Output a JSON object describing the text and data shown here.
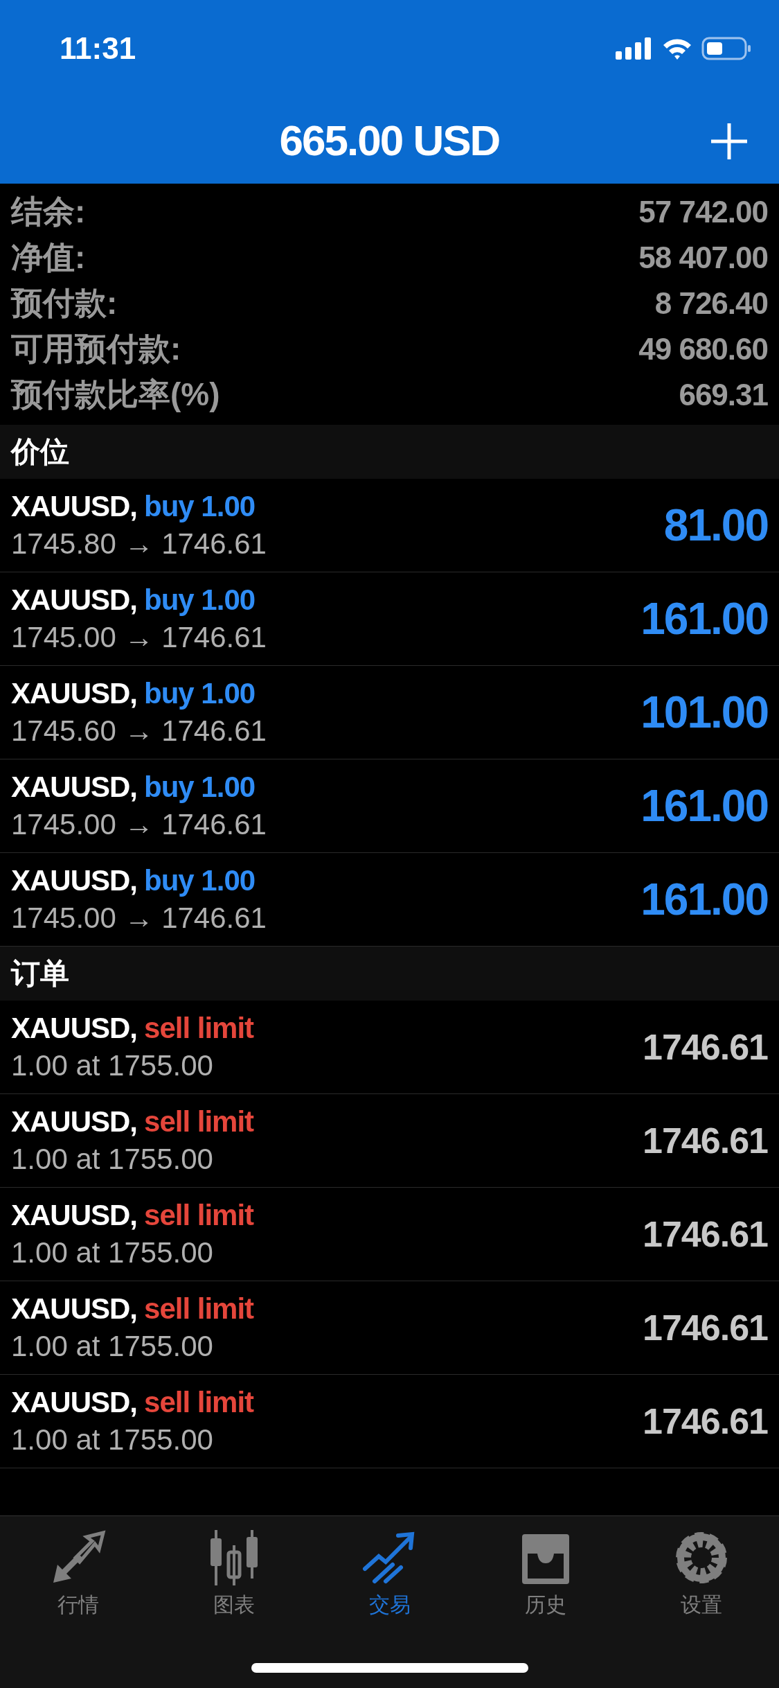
{
  "status_bar": {
    "time": "11:31"
  },
  "header": {
    "title": "665.00 USD"
  },
  "summary": [
    {
      "label": "结余:",
      "value": "57 742.00"
    },
    {
      "label": "净值:",
      "value": "58 407.00"
    },
    {
      "label": "预付款:",
      "value": "8 726.40"
    },
    {
      "label": "可用预付款:",
      "value": "49 680.60"
    },
    {
      "label": "预付款比率(%)",
      "value": "669.31"
    }
  ],
  "positions": {
    "title": "价位",
    "rows": [
      {
        "symbol": "XAUUSD,",
        "kind": "buy",
        "type": "buy 1.00",
        "prices": "1745.80 → 1746.61",
        "profit": "81.00"
      },
      {
        "symbol": "XAUUSD,",
        "kind": "buy",
        "type": "buy 1.00",
        "prices": "1745.00 → 1746.61",
        "profit": "161.00"
      },
      {
        "symbol": "XAUUSD,",
        "kind": "buy",
        "type": "buy 1.00",
        "prices": "1745.60 → 1746.61",
        "profit": "101.00"
      },
      {
        "symbol": "XAUUSD,",
        "kind": "buy",
        "type": "buy 1.00",
        "prices": "1745.00 → 1746.61",
        "profit": "161.00"
      },
      {
        "symbol": "XAUUSD,",
        "kind": "buy",
        "type": "buy 1.00",
        "prices": "1745.00 → 1746.61",
        "profit": "161.00"
      }
    ]
  },
  "orders": {
    "title": "订单",
    "rows": [
      {
        "symbol": "XAUUSD,",
        "kind": "sell",
        "type": "sell limit",
        "detail": "1.00 at 1755.00",
        "price": "1746.61"
      },
      {
        "symbol": "XAUUSD,",
        "kind": "sell",
        "type": "sell limit",
        "detail": "1.00 at 1755.00",
        "price": "1746.61"
      },
      {
        "symbol": "XAUUSD,",
        "kind": "sell",
        "type": "sell limit",
        "detail": "1.00 at 1755.00",
        "price": "1746.61"
      },
      {
        "symbol": "XAUUSD,",
        "kind": "sell",
        "type": "sell limit",
        "detail": "1.00 at 1755.00",
        "price": "1746.61"
      },
      {
        "symbol": "XAUUSD,",
        "kind": "sell",
        "type": "sell limit",
        "detail": "1.00 at 1755.00",
        "price": "1746.61"
      }
    ]
  },
  "tab_bar": [
    {
      "label": "行情",
      "kind": "quotes",
      "selected": false
    },
    {
      "label": "图表",
      "kind": "chart",
      "selected": false
    },
    {
      "label": "交易",
      "kind": "trade",
      "selected": true
    },
    {
      "label": "历史",
      "kind": "history",
      "selected": false
    },
    {
      "label": "设置",
      "kind": "settings",
      "selected": false
    }
  ]
}
